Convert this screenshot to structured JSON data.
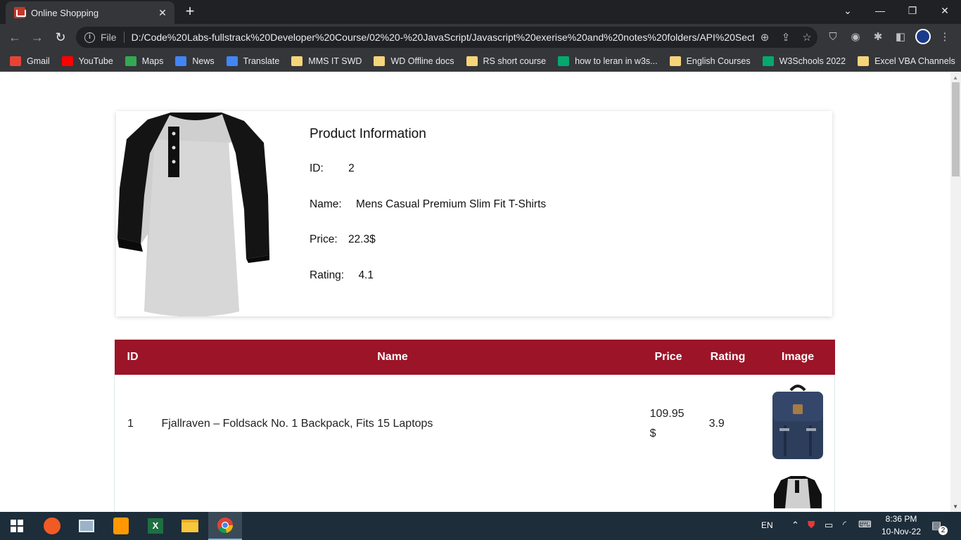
{
  "browser": {
    "tab_title": "Online Shopping",
    "tab_close": "✕",
    "new_tab": "+",
    "file_label": "File",
    "url": "D:/Code%20Labs-fullstrack%20Developer%20Course/02%20-%20JavaScript/Javascript%20exerise%20and%20notes%20folders/API%20Sectio...",
    "bookmarks": [
      {
        "label": "Gmail",
        "icon": "gmail-icon",
        "color": "#ea4335"
      },
      {
        "label": "YouTube",
        "icon": "youtube-icon",
        "color": "#ff0000"
      },
      {
        "label": "Maps",
        "icon": "maps-icon",
        "color": "#34a853"
      },
      {
        "label": "News",
        "icon": "news-icon",
        "color": "#4285f4"
      },
      {
        "label": "Translate",
        "icon": "translate-icon",
        "color": "#4285f4"
      },
      {
        "label": "MMS IT SWD",
        "icon": "folder-icon",
        "color": "#f6d47a"
      },
      {
        "label": "WD Offline docs",
        "icon": "folder-icon",
        "color": "#f6d47a"
      },
      {
        "label": "RS short course",
        "icon": "folder-icon",
        "color": "#f6d47a"
      },
      {
        "label": "how to leran in w3s...",
        "icon": "w3schools-icon",
        "color": "#04aa6d"
      },
      {
        "label": "English Courses",
        "icon": "folder-icon",
        "color": "#f6d47a"
      },
      {
        "label": "W3Schools 2022",
        "icon": "w3schools-icon",
        "color": "#04aa6d"
      },
      {
        "label": "Excel VBA Channels",
        "icon": "folder-icon",
        "color": "#f6d47a"
      }
    ]
  },
  "product": {
    "heading": "Product Information",
    "id_label": "ID:",
    "id_value": "2",
    "name_label": "Name:",
    "name_value": "Mens Casual Premium Slim Fit T-Shirts",
    "price_label": "Price:",
    "price_value": "22.3$",
    "rating_label": "Rating:",
    "rating_value": "4.1",
    "image": "tshirt-image"
  },
  "table": {
    "headers": {
      "id": "ID",
      "name": "Name",
      "price": "Price",
      "rating": "Rating",
      "image": "Image"
    },
    "rows": [
      {
        "id": "1",
        "name": "Fjallraven – Foldsack No. 1 Backpack, Fits 15 Laptops",
        "price": "109.95",
        "currency": "$",
        "rating": "3.9",
        "image": "backpack-image"
      }
    ]
  },
  "taskbar": {
    "language": "EN",
    "time": "8:36 PM",
    "date": "10-Nov-22",
    "notifications": "2"
  },
  "colors": {
    "table_header": "#9b1428",
    "chrome_dark": "#202124",
    "chrome_toolbar": "#35363a",
    "taskbar": "#1d2d3a"
  }
}
